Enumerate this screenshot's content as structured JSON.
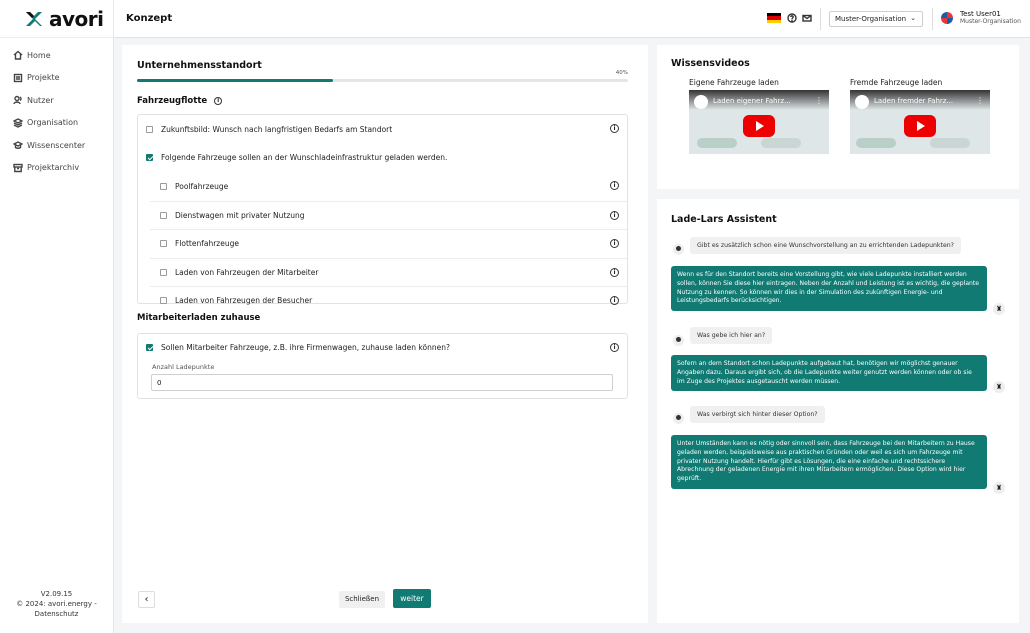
{
  "app": {
    "logo": "avori",
    "page_title": "Konzept"
  },
  "sidebar": {
    "items": [
      {
        "label": "Home",
        "icon": "home-icon"
      },
      {
        "label": "Projekte",
        "icon": "projects-icon"
      },
      {
        "label": "Nutzer",
        "icon": "users-icon"
      },
      {
        "label": "Organisation",
        "icon": "organisation-icon"
      },
      {
        "label": "Wissenscenter",
        "icon": "graduation-cap-icon"
      },
      {
        "label": "Projektarchiv",
        "icon": "archive-icon"
      }
    ],
    "footer": {
      "version": "V2.09.15",
      "copyright": "© 2024: avori.energy -",
      "privacy": "Datenschutz"
    }
  },
  "topbar": {
    "org_select": "Muster-Organisation",
    "user_name": "Test User01",
    "user_org": "Muster-Organisation"
  },
  "main": {
    "section_title": "Unternehmensstandort",
    "progress": 0.4,
    "progress_label": "40%",
    "fleet": {
      "title": "Fahrzeugflotte",
      "option_future": "Zukunftsbild: Wunsch nach langfristigen Bedarfs am Standort",
      "option_vehicles": "Folgende Fahrzeuge sollen an der Wunschladeinfrastruktur geladen werden.",
      "sub_options": [
        "Poolfahrzeuge",
        "Dienstwagen mit privater Nutzung",
        "Flottenfahrzeuge",
        "Laden von Fahrzeugen der Mitarbeiter",
        "Laden von Fahrzeugen der Besucher"
      ]
    },
    "home": {
      "title": "Mitarbeiterladen zuhause",
      "question": "Sollen Mitarbeiter Fahrzeuge, z.B. ihre Firmenwagen, zuhause laden können?",
      "field_label": "Anzahl Ladepunkte",
      "field_value": "0"
    },
    "buttons": {
      "close": "Schließen",
      "next": "weiter"
    }
  },
  "videos": {
    "title": "Wissensvideos",
    "items": [
      {
        "label": "Eigene Fahrzeuge laden",
        "video_title": "Laden eigener Fahrz..."
      },
      {
        "label": "Fremde Fahrzeuge laden",
        "video_title": "Laden fremder Fahrz..."
      }
    ]
  },
  "assistant": {
    "title": "Lade-Lars Assistent",
    "messages": [
      {
        "q": "Gibt es zusätzlich schon eine Wunschvorstellung an zu errichtenden Ladepunkten?",
        "a": "Wenn es für den Standort bereits eine Vorstellung gibt, wie viele Ladepunkte installiert werden sollen, können Sie diese hier eintragen. Neben der Anzahl und Leistung ist es wichtig, die geplante Nutzung zu kennen. So können wir dies in der Simulation des zukünftigen Energie- und Leistungsbedarfs berücksichtigen."
      },
      {
        "q": "Was gebe ich hier an?",
        "a": "Sofern an dem Standort schon Ladepunkte aufgebaut hat, benötigen wir möglichst genauer Angaben dazu. Daraus ergibt sich, ob die Ladepunkte weiter genutzt werden können oder ob sie im Zuge des Projektes ausgetauscht werden müssen."
      },
      {
        "q": "Was verbirgt sich hinter dieser Option?",
        "a": "Unter Umständen kann es nötig oder sinnvoll sein, dass Fahrzeuge bei den Mitarbeitern zu Hause geladen werden, beispielsweise aus praktischen Gründen oder weil es sich um Fahrzeuge mit privater Nutzung handelt. Hierfür gibt es Lösungen, die eine einfache und rechtssichere Abrechnung der geladenen Energie mit ihren Mitarbeitern ermöglichen. Diese Option wird hier geprüft."
      }
    ]
  },
  "colors": {
    "accent": "#117a73"
  }
}
